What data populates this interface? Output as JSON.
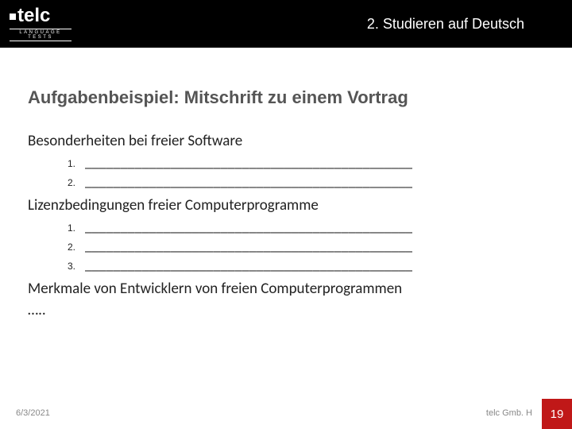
{
  "logo": {
    "text": "telc",
    "sub": "LANGUAGE TESTS"
  },
  "header": {
    "section": "2. Studieren auf Deutsch"
  },
  "title": "Aufgabenbeispiel: Mitschrift zu einem Vortrag",
  "blanks": "______________________________________________",
  "blocks": [
    {
      "heading": "Besonderheiten bei freier Software",
      "items": [
        "1.",
        "2."
      ]
    },
    {
      "heading": "Lizenzbedingungen freier Computerprogramme",
      "items": [
        "1.",
        "2.",
        "3."
      ]
    },
    {
      "heading": "Merkmale von Entwicklern von freien Computerprogrammen",
      "items": []
    }
  ],
  "ellipsis": "…..",
  "footer": {
    "date": "6/3/2021",
    "brand": "telc Gmb. H",
    "page": "19"
  }
}
